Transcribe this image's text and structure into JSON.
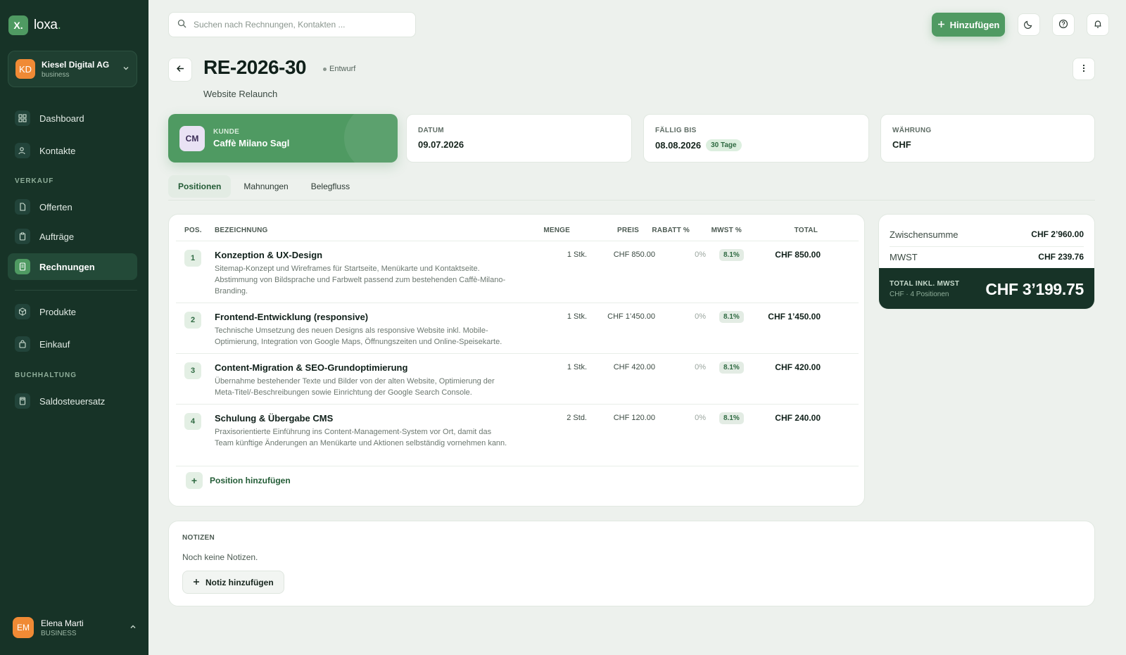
{
  "brand": {
    "mark": "X.",
    "name": "loxa",
    "dot": "."
  },
  "org": {
    "initials": "KD",
    "name": "Kiesel Digital AG",
    "plan": "business"
  },
  "nav": {
    "dashboard": "Dashboard",
    "contacts": "Kontakte",
    "section_sales": "VERKAUF",
    "offers": "Offerten",
    "orders": "Aufträge",
    "invoices": "Rechnungen",
    "products": "Produkte",
    "purchasing": "Einkauf",
    "section_accounting": "BUCHHALTUNG",
    "tax_rate": "Saldosteuersatz"
  },
  "user": {
    "initials": "EM",
    "name": "Elena Marti",
    "role": "BUSINESS"
  },
  "header": {
    "search_placeholder": "Suchen nach Rechnungen, Kontakten ...",
    "add_label": "Hinzufügen"
  },
  "invoice": {
    "number": "RE-2026-30",
    "status": "Entwurf",
    "subtitle": "Website Relaunch"
  },
  "cards": {
    "customer_label": "KUNDE",
    "customer_initials": "CM",
    "customer_name": "Caffè Milano Sagl",
    "date_label": "DATUM",
    "date_value": "09.07.2026",
    "due_label": "FÄLLIG BIS",
    "due_value": "08.08.2026",
    "due_days": "30 Tage",
    "currency_label": "WÄHRUNG",
    "currency_value": "CHF"
  },
  "tabs": [
    "Positionen",
    "Mahnungen",
    "Belegfluss"
  ],
  "table": {
    "headers": {
      "pos": "POS.",
      "desc": "BEZEICHNUNG",
      "qty": "MENGE",
      "price": "PREIS",
      "discount": "RABATT %",
      "vat": "MWST %",
      "total": "TOTAL"
    },
    "rows": [
      {
        "pos": "1",
        "name": "Konzeption & UX-Design",
        "desc": "Sitemap-Konzept und Wireframes für Startseite, Menükarte und Kontaktseite. Abstimmung von Bildsprache und Farbwelt passend zum bestehenden Caffè-Milano-Branding.",
        "qty": "1 Stk.",
        "price": "CHF 850.00",
        "discount": "0%",
        "vat": "8.1%",
        "total": "CHF 850.00"
      },
      {
        "pos": "2",
        "name": "Frontend-Entwicklung (responsive)",
        "desc": "Technische Umsetzung des neuen Designs als responsive Website inkl. Mobile-Optimierung, Integration von Google Maps, Öffnungszeiten und Online-Speisekarte.",
        "qty": "1 Stk.",
        "price": "CHF 1’450.00",
        "discount": "0%",
        "vat": "8.1%",
        "total": "CHF 1’450.00"
      },
      {
        "pos": "3",
        "name": "Content-Migration & SEO-Grundoptimierung",
        "desc": "Übernahme bestehender Texte und Bilder von der alten Website, Optimierung der Meta-Titel/-Beschreibungen sowie Einrichtung der Google Search Console.",
        "qty": "1 Stk.",
        "price": "CHF 420.00",
        "discount": "0%",
        "vat": "8.1%",
        "total": "CHF 420.00"
      },
      {
        "pos": "4",
        "name": "Schulung & Übergabe CMS",
        "desc": "Praxisorientierte Einführung ins Content-Management-System vor Ort, damit das Team künftige Änderungen an Menükarte und Aktionen selbständig vornehmen kann.",
        "qty": "2 Std.",
        "price": "CHF 120.00",
        "discount": "0%",
        "vat": "8.1%",
        "total": "CHF 240.00"
      }
    ],
    "add_position": "Position hinzufügen"
  },
  "summary": {
    "subtotal_label": "Zwischensumme",
    "subtotal_value": "CHF 2’960.00",
    "vat_label": "MWST",
    "vat_value": "CHF 239.76",
    "total_label": "TOTAL INKL. MWST",
    "total_sub": "CHF · 4 Positionen",
    "total_value": "CHF 3’199.75"
  },
  "notes": {
    "label": "NOTIZEN",
    "empty": "Noch keine Notizen.",
    "add": "Notiz hinzufügen"
  }
}
